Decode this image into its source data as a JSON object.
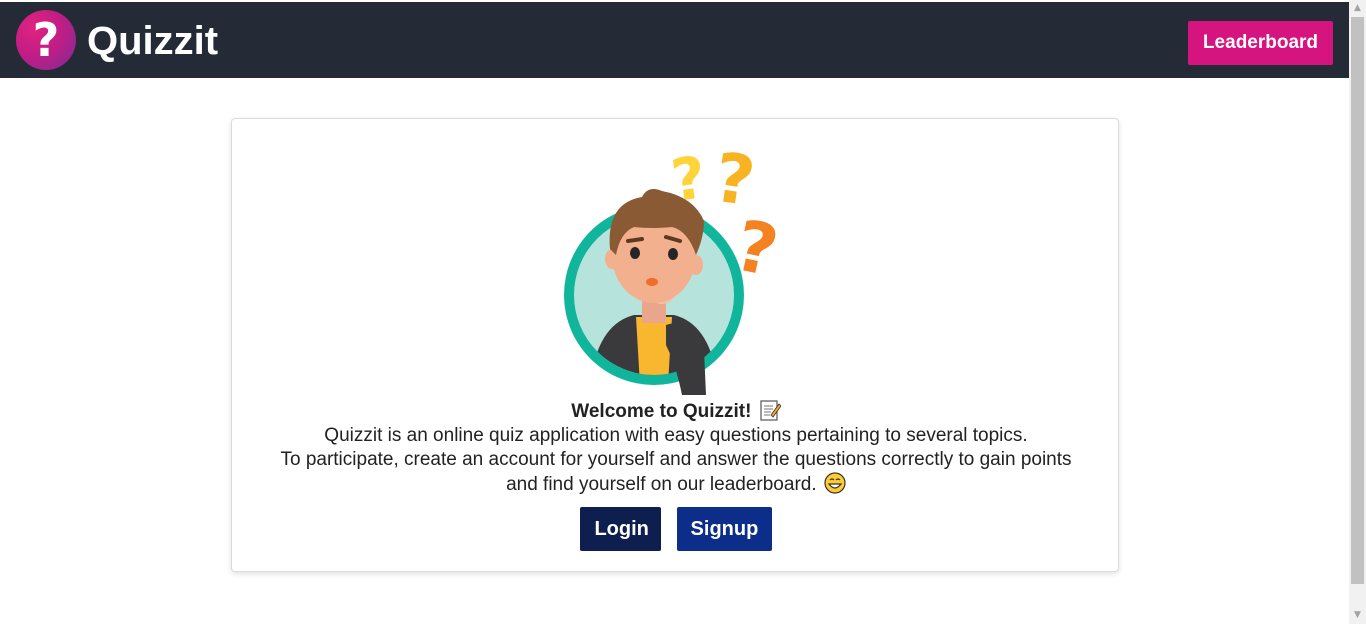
{
  "header": {
    "brand": "Quizzit",
    "logo_glyph": "?",
    "leaderboard_label": "Leaderboard"
  },
  "welcome": {
    "title": "Welcome to Quizzit!",
    "line1": "Quizzit is an online quiz application with easy questions pertaining to several topics.",
    "line2": "To participate, create an account for yourself and answer the questions correctly to gain points and find yourself on our leaderboard.",
    "title_icon": "memo-icon",
    "end_icon": "grinning-face-icon"
  },
  "actions": {
    "login_label": "Login",
    "signup_label": "Signup"
  },
  "colors": {
    "header_bg": "#252a37",
    "accent_pink": "#d6147f",
    "login_bg": "#0e1f4f",
    "signup_bg": "#0c2d8a"
  }
}
